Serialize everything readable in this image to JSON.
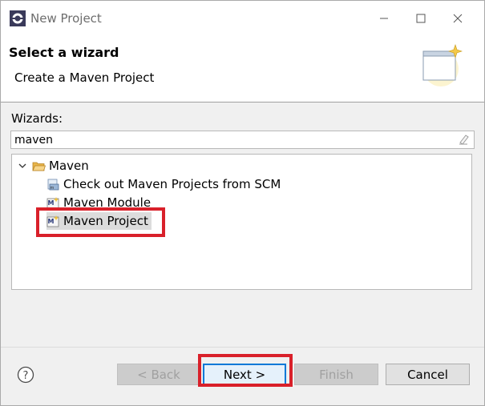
{
  "window": {
    "title": "New Project",
    "icon": "eclipse-icon"
  },
  "header": {
    "title": "Select a wizard",
    "description": "Create a Maven Project",
    "graphic": "wizard-banner-icon"
  },
  "filter": {
    "label": "Wizards:",
    "value": "maven"
  },
  "tree": {
    "root": {
      "label": "Maven",
      "icon": "folder-open-icon",
      "expanded": true
    },
    "items": [
      {
        "label": "Check out Maven Projects from SCM",
        "icon": "maven-scm-icon"
      },
      {
        "label": "Maven Module",
        "icon": "maven-module-icon"
      },
      {
        "label": "Maven Project",
        "icon": "maven-project-icon",
        "selected": true
      }
    ]
  },
  "buttons": {
    "help": "help-icon",
    "back": "< Back",
    "next": "Next >",
    "finish": "Finish",
    "cancel": "Cancel"
  },
  "colors": {
    "highlight": "#d9202a",
    "default_button_border": "#0078d7",
    "selection": "#dcdcdc"
  }
}
